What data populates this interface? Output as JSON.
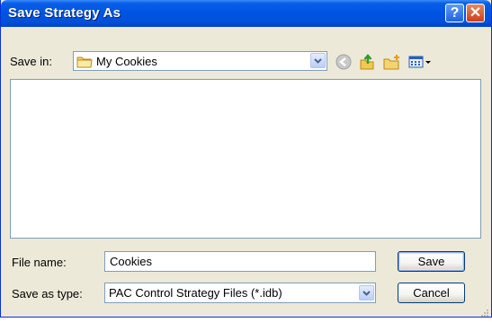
{
  "window": {
    "title": "Save Strategy As",
    "help_label": "?",
    "close_label": "✕"
  },
  "location": {
    "label": "Save in:",
    "value": "My Cookies"
  },
  "toolbar": {
    "icons": [
      "back-icon",
      "up-folder-icon",
      "new-folder-icon",
      "view-menu-icon"
    ]
  },
  "file_name": {
    "label": "File name:",
    "value": "Cookies"
  },
  "file_type": {
    "label": "Save as type:",
    "value": "PAC Control Strategy Files (*.idb)"
  },
  "buttons": {
    "save": "Save",
    "cancel": "Cancel"
  },
  "colors": {
    "title_bar": "#0054E3",
    "dialog_bg": "#ECE9D8",
    "close_button": "#C9401C"
  }
}
